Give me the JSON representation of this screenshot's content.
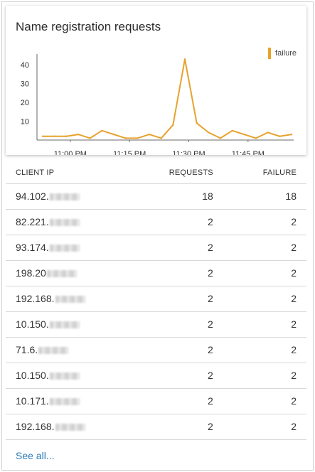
{
  "card": {
    "title": "Name registration requests",
    "see_all_label": "See all..."
  },
  "colors": {
    "series_failure": "#e8a22d",
    "link": "#2a7ab8"
  },
  "chart_data": {
    "type": "line",
    "title": "Name registration requests",
    "series": [
      {
        "name": "failure",
        "x": [
          "10:53 PM",
          "10:56 PM",
          "10:59 PM",
          "11:02 PM",
          "11:05 PM",
          "11:08 PM",
          "11:11 PM",
          "11:14 PM",
          "11:17 PM",
          "11:20 PM",
          "11:23 PM",
          "11:26 PM",
          "11:29 PM",
          "11:32 PM",
          "11:35 PM",
          "11:38 PM",
          "11:41 PM",
          "11:44 PM",
          "11:47 PM",
          "11:50 PM",
          "11:53 PM",
          "11:56 PM"
        ],
        "values": [
          2,
          2,
          2,
          3,
          1,
          5,
          3,
          1,
          1,
          3,
          1,
          8,
          43,
          9,
          4,
          1,
          5,
          3,
          1,
          4,
          2,
          3
        ]
      }
    ],
    "yticks": [
      10,
      20,
      30,
      40
    ],
    "xticks": [
      "11:00 PM",
      "11:15 PM",
      "11:30 PM",
      "11:45 PM"
    ],
    "ylim": [
      0,
      45
    ],
    "legend_position": "top-right"
  },
  "table": {
    "headers": {
      "ip": "CLIENT IP",
      "requests": "REQUESTS",
      "failure": "FAILURE"
    },
    "rows": [
      {
        "ip": "94.102.",
        "requests": "18",
        "failure": "18"
      },
      {
        "ip": "82.221.",
        "requests": "2",
        "failure": "2"
      },
      {
        "ip": "93.174.",
        "requests": "2",
        "failure": "2"
      },
      {
        "ip": "198.20",
        "requests": "2",
        "failure": "2"
      },
      {
        "ip": "192.168.",
        "requests": "2",
        "failure": "2"
      },
      {
        "ip": "10.150.",
        "requests": "2",
        "failure": "2"
      },
      {
        "ip": "71.6.",
        "requests": "2",
        "failure": "2"
      },
      {
        "ip": "10.150.",
        "requests": "2",
        "failure": "2"
      },
      {
        "ip": "10.171.",
        "requests": "2",
        "failure": "2"
      },
      {
        "ip": "192.168.",
        "requests": "2",
        "failure": "2"
      }
    ]
  }
}
